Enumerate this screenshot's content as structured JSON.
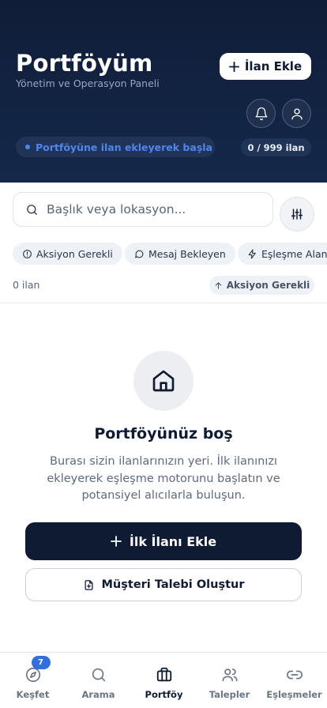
{
  "header": {
    "title": "Portföyüm",
    "subtitle": "Yönetim ve Operasyon Paneli",
    "add_button": "İlan Ekle",
    "hint": "Portföyüne ilan ekleyerek başla",
    "count_pill": "0 / 999 ilan",
    "icons": {
      "add": "plus-icon",
      "notifications": "bell-icon",
      "profile": "user-icon"
    }
  },
  "search": {
    "placeholder": "Başlık veya lokasyon...",
    "value": ""
  },
  "chips": [
    {
      "label": "Aksiyon Gerekli",
      "icon": "alert-circle-icon"
    },
    {
      "label": "Mesaj Bekleyen",
      "icon": "message-icon"
    },
    {
      "label": "Eşleşme Alanı",
      "icon": "lightning-icon"
    }
  ],
  "list": {
    "count": "0 ilan",
    "sort_label": "Aksiyon Gerekli"
  },
  "empty_state": {
    "title": "Portföyünüz boş",
    "description": "Burası sizin ilanlarınızın yeri. İlk ilanınızı ekleyerek eşleşme motorunu başlatın ve potansiyel alıcılarla buluşun.",
    "primary_button": "İlk İlanı Ekle",
    "secondary_button": "Müşteri Talebi Oluştur"
  },
  "nav": {
    "active": "Portföy",
    "items": [
      {
        "label": "Keşfet",
        "icon": "compass-icon",
        "badge": "7"
      },
      {
        "label": "Arama",
        "icon": "search-icon"
      },
      {
        "label": "Portföy",
        "icon": "briefcase-icon"
      },
      {
        "label": "Talepler",
        "icon": "users-icon"
      },
      {
        "label": "Eşleşmeler",
        "icon": "link-icon"
      }
    ]
  },
  "colors": {
    "header_bg": "#101d38",
    "accent": "#4d86f0",
    "primary": "#0f1b33",
    "badge": "#2f6fe0"
  }
}
